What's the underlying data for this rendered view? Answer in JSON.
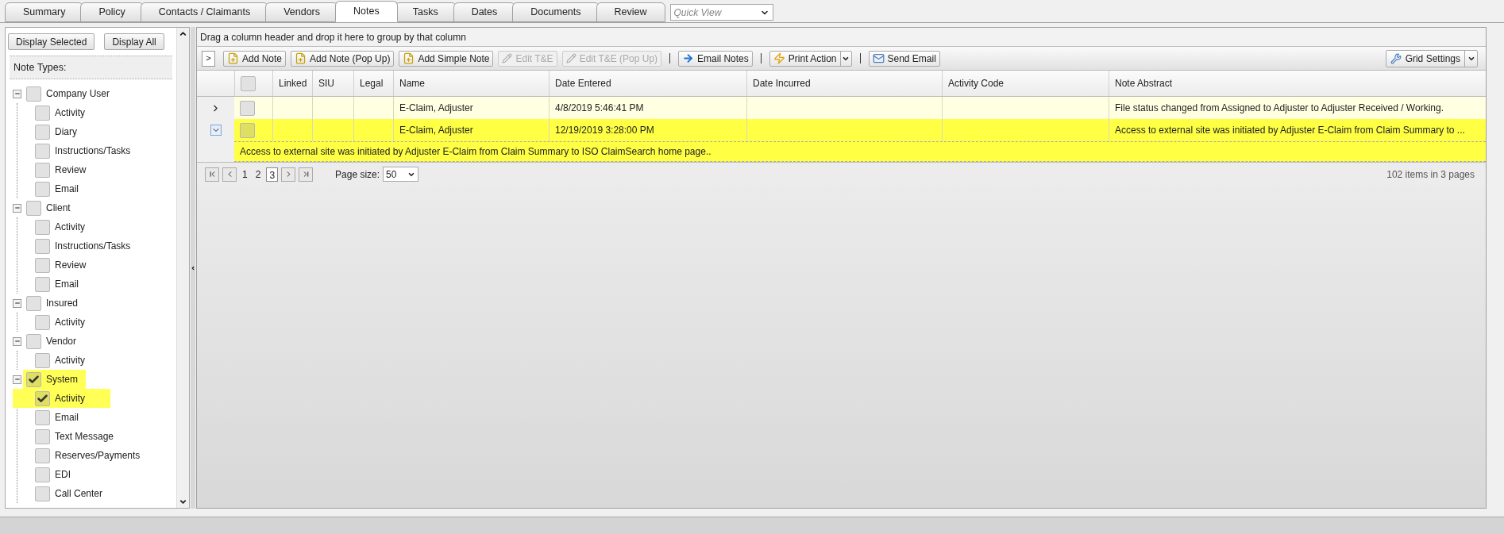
{
  "tabs": [
    {
      "label": "Summary",
      "selected": false
    },
    {
      "label": "Policy",
      "selected": false
    },
    {
      "label": "Contacts / Claimants",
      "selected": false
    },
    {
      "label": "Vendors",
      "selected": false
    },
    {
      "label": "Notes",
      "selected": true
    },
    {
      "label": "Tasks",
      "selected": false
    },
    {
      "label": "Dates",
      "selected": false
    },
    {
      "label": "Documents",
      "selected": false
    },
    {
      "label": "Review",
      "selected": false
    }
  ],
  "quick_view": {
    "placeholder": "Quick View"
  },
  "note_types_panel": {
    "buttons": [
      "Display Selected",
      "Display All"
    ],
    "title": "Note Types:",
    "tree": [
      {
        "label": "Company User",
        "checked": false,
        "highlighted": false,
        "expanded": true,
        "children": [
          {
            "label": "Activity",
            "checked": false,
            "highlighted": false
          },
          {
            "label": "Diary",
            "checked": false,
            "highlighted": false
          },
          {
            "label": "Instructions/Tasks",
            "checked": false,
            "highlighted": false
          },
          {
            "label": "Review",
            "checked": false,
            "highlighted": false
          },
          {
            "label": "Email",
            "checked": false,
            "highlighted": false
          }
        ]
      },
      {
        "label": "Client",
        "checked": false,
        "highlighted": false,
        "expanded": true,
        "children": [
          {
            "label": "Activity",
            "checked": false,
            "highlighted": false
          },
          {
            "label": "Instructions/Tasks",
            "checked": false,
            "highlighted": false
          },
          {
            "label": "Review",
            "checked": false,
            "highlighted": false
          },
          {
            "label": "Email",
            "checked": false,
            "highlighted": false
          }
        ]
      },
      {
        "label": "Insured",
        "checked": false,
        "highlighted": false,
        "expanded": true,
        "children": [
          {
            "label": "Activity",
            "checked": false,
            "highlighted": false
          }
        ]
      },
      {
        "label": "Vendor",
        "checked": false,
        "highlighted": false,
        "expanded": true,
        "children": [
          {
            "label": "Activity",
            "checked": false,
            "highlighted": false
          }
        ]
      },
      {
        "label": "System",
        "checked": true,
        "highlighted": true,
        "expanded": true,
        "children": [
          {
            "label": "Activity",
            "checked": true,
            "highlighted": true
          },
          {
            "label": "Email",
            "checked": false,
            "highlighted": false
          },
          {
            "label": "Text Message",
            "checked": false,
            "highlighted": false
          },
          {
            "label": "Reserves/Payments",
            "checked": false,
            "highlighted": false
          },
          {
            "label": "EDI",
            "checked": false,
            "highlighted": false
          },
          {
            "label": "Call Center",
            "checked": false,
            "highlighted": false
          }
        ]
      }
    ]
  },
  "grid": {
    "group_hint": "Drag a column header and drop it here to group by that column",
    "toolbar": [
      {
        "kind": "toggle",
        "label": ">"
      },
      {
        "kind": "button",
        "label": "Add Note",
        "disabled": false
      },
      {
        "kind": "button",
        "label": "Add Note (Pop Up)",
        "disabled": false
      },
      {
        "kind": "button",
        "label": "Add Simple Note",
        "disabled": false
      },
      {
        "kind": "button",
        "label": "Edit T&E",
        "disabled": true
      },
      {
        "kind": "button",
        "label": "Edit T&E (Pop Up)",
        "disabled": true
      },
      {
        "kind": "separator"
      },
      {
        "kind": "button",
        "label": "Email Notes",
        "disabled": false
      },
      {
        "kind": "separator"
      },
      {
        "kind": "split",
        "label": "Print Action",
        "disabled": false
      },
      {
        "kind": "separator"
      },
      {
        "kind": "button",
        "label": "Send Email",
        "disabled": false
      }
    ],
    "grid_settings": {
      "label": "Grid Settings"
    },
    "columns": [
      {
        "kind": "checkbox",
        "checked": false
      },
      {
        "kind": "text",
        "label": "Linked"
      },
      {
        "kind": "text",
        "label": "SIU"
      },
      {
        "kind": "text",
        "label": "Legal"
      },
      {
        "kind": "text",
        "label": "Name"
      },
      {
        "kind": "text",
        "label": "Date Entered"
      },
      {
        "kind": "text",
        "label": "Date Incurred"
      },
      {
        "kind": "text",
        "label": "Activity Code"
      },
      {
        "kind": "text",
        "label": "Note Abstract"
      }
    ],
    "rows": [
      {
        "expanded": false,
        "checked": false,
        "highlighted": false,
        "name": "E-Claim, Adjuster",
        "date_entered": "4/8/2019 5:46:41 PM",
        "note_abstract": "File status changed from Assigned to Adjuster to Adjuster Received / Working."
      },
      {
        "expanded": true,
        "checked": false,
        "highlighted": true,
        "name": "E-Claim, Adjuster",
        "date_entered": "12/19/2019 3:28:00 PM",
        "note_abstract": "Access to external site was initiated by Adjuster E-Claim from Claim Summary to ...",
        "detail": "Access to external site was initiated by Adjuster E-Claim from Claim Summary to ISO ClaimSearch home page.."
      }
    ],
    "pager": {
      "pages": [
        {
          "label": "1",
          "selected": false
        },
        {
          "label": "2",
          "selected": false
        },
        {
          "label": "3",
          "selected": true
        }
      ],
      "page_size_label": "Page size:",
      "page_size": "50",
      "summary": "102 items in 3 pages"
    }
  }
}
